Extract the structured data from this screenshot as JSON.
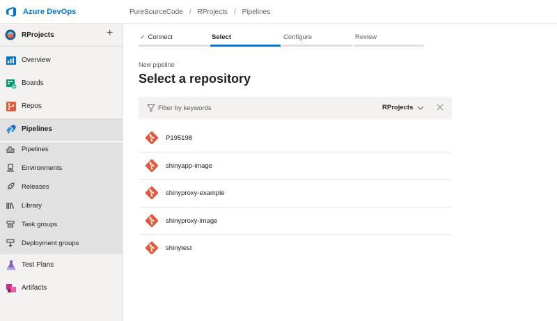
{
  "header": {
    "brand": "Azure DevOps",
    "breadcrumb": [
      "PureSourceCode",
      "RProjects",
      "Pipelines"
    ],
    "brand_color": "#0078d4"
  },
  "sidebar": {
    "project": {
      "name": "RProjects",
      "add_icon": "plus-icon"
    },
    "items": [
      {
        "label": "Overview",
        "icon": "overview-icon"
      },
      {
        "label": "Boards",
        "icon": "boards-icon"
      },
      {
        "label": "Repos",
        "icon": "repos-icon"
      },
      {
        "label": "Pipelines",
        "icon": "pipelines-icon",
        "active": true
      },
      {
        "label": "Test Plans",
        "icon": "test-plans-icon"
      },
      {
        "label": "Artifacts",
        "icon": "artifacts-icon"
      }
    ],
    "pipelines_sub": [
      {
        "label": "Pipelines",
        "icon": "pipelines-sub-icon"
      },
      {
        "label": "Environments",
        "icon": "environments-icon"
      },
      {
        "label": "Releases",
        "icon": "releases-icon"
      },
      {
        "label": "Library",
        "icon": "library-icon"
      },
      {
        "label": "Task groups",
        "icon": "task-groups-icon"
      },
      {
        "label": "Deployment groups",
        "icon": "deployment-groups-icon"
      }
    ]
  },
  "wizard": {
    "steps": [
      {
        "label": "Connect",
        "state": "done"
      },
      {
        "label": "Select",
        "state": "active"
      },
      {
        "label": "Configure",
        "state": "pending"
      },
      {
        "label": "Review",
        "state": "pending"
      }
    ],
    "kicker": "New pipeline",
    "title": "Select a repository"
  },
  "filter": {
    "placeholder": "Filter by keywords",
    "scope": "RProjects"
  },
  "repositories": [
    "P195198",
    "shinyapp-image",
    "shinyproxy-example",
    "shinyproxy-image",
    "shinytest"
  ],
  "colors": {
    "accent": "#0078d4",
    "git": "#e05a3a"
  }
}
